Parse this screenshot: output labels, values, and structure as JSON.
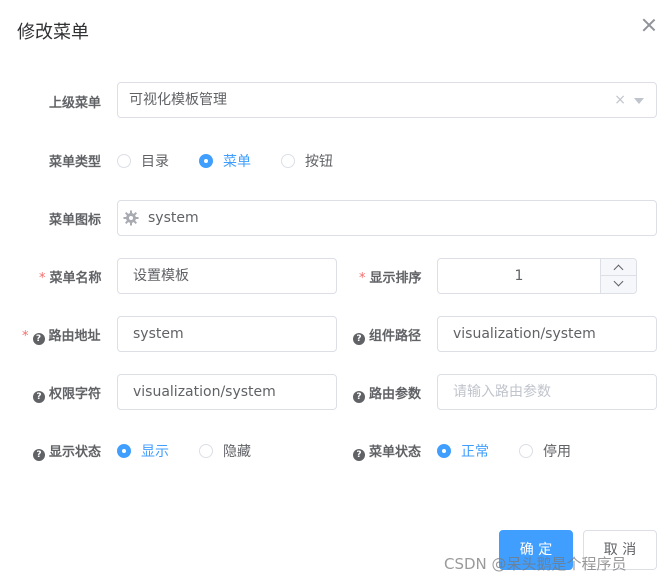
{
  "dialog": {
    "title": "修改菜单"
  },
  "form": {
    "parent_menu": {
      "label": "上级菜单",
      "value": "可视化模板管理"
    },
    "menu_type": {
      "label": "菜单类型",
      "options": [
        "目录",
        "菜单",
        "按钮"
      ],
      "selected": "菜单"
    },
    "menu_icon": {
      "label": "菜单图标",
      "value": "system",
      "icon": "gear-icon"
    },
    "menu_name": {
      "label": "菜单名称",
      "required_mark": "*",
      "value": "设置模板"
    },
    "display_order": {
      "label": "显示排序",
      "required_mark": "*",
      "value": "1"
    },
    "route_address": {
      "label": "路由地址",
      "required_mark": "*",
      "value": "system"
    },
    "component_path": {
      "label": "组件路径",
      "value": "visualization/system"
    },
    "permission": {
      "label": "权限字符",
      "value": "visualization/system"
    },
    "route_params": {
      "label": "路由参数",
      "placeholder": "请输入路由参数"
    },
    "display_status": {
      "label": "显示状态",
      "options": [
        "显示",
        "隐藏"
      ],
      "selected": "显示"
    },
    "menu_status": {
      "label": "菜单状态",
      "options": [
        "正常",
        "停用"
      ],
      "selected": "正常"
    }
  },
  "footer": {
    "confirm_label": "确 定",
    "cancel_label": "取 消"
  },
  "watermark": "CSDN @呆头鹅是个程序员",
  "colors": {
    "primary": "#409eff",
    "required": "#f56c6c",
    "border": "#dcdfe6"
  }
}
